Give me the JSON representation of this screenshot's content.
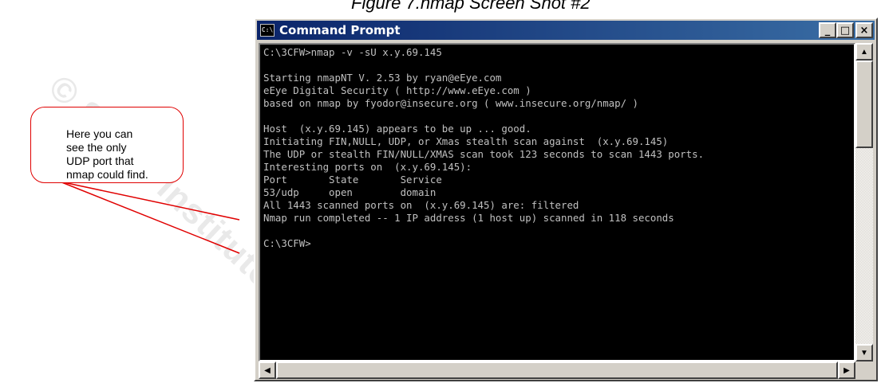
{
  "figure": {
    "title": "Figure 7.nmap Screen Shot #2",
    "watermark": "© SANS Institute"
  },
  "callout": {
    "text": "Here you can\nsee the only\nUDP port that\nnmap could find."
  },
  "window": {
    "title": "Command Prompt",
    "icon_label": "C:\\",
    "buttons": {
      "minimize": "_",
      "maximize": "□",
      "close": "×"
    }
  },
  "console": {
    "lines": [
      "C:\\3CFW>nmap -v -sU x.y.69.145",
      "",
      "Starting nmapNT V. 2.53 by ryan@eEye.com",
      "eEye Digital Security ( http://www.eEye.com )",
      "based on nmap by fyodor@insecure.org ( www.insecure.org/nmap/ )",
      "",
      "Host  (x.y.69.145) appears to be up ... good.",
      "Initiating FIN,NULL, UDP, or Xmas stealth scan against  (x.y.69.145)",
      "The UDP or stealth FIN/NULL/XMAS scan took 123 seconds to scan 1443 ports.",
      "Interesting ports on  (x.y.69.145):",
      "Port       State       Service",
      "53/udp     open        domain",
      "All 1443 scanned ports on  (x.y.69.145) are: filtered",
      "Nmap run completed -- 1 IP address (1 host up) scanned in 118 seconds",
      "",
      "C:\\3CFW>"
    ]
  },
  "scrollbar": {
    "up": "▲",
    "down": "▼",
    "left": "◀",
    "right": "▶"
  },
  "colors": {
    "callout_border": "#e00000",
    "titlebar": "#0a246a",
    "console_bg": "#000000",
    "console_fg": "#c0c0c0"
  }
}
